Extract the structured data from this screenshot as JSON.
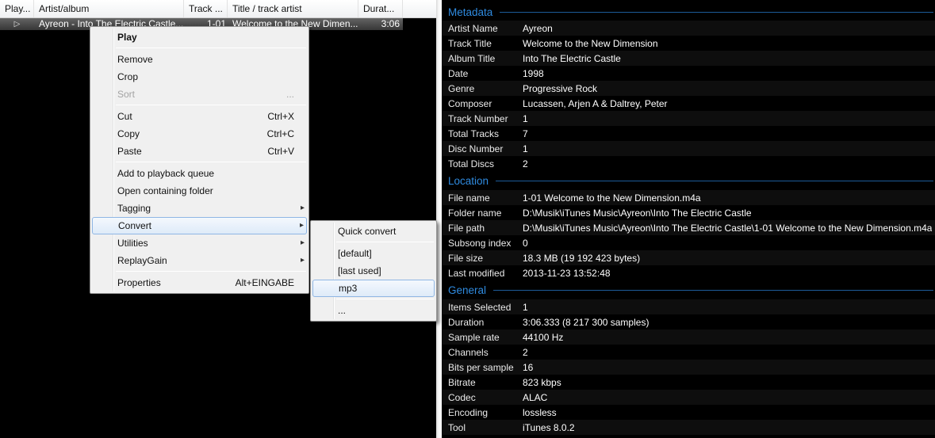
{
  "icons": {
    "play_indicator": "▷",
    "submenu_arrow": "▸"
  },
  "colors": {
    "accent_blue": "#2f8be0",
    "section_line_blue": "#1d5c99",
    "menu_highlight_border": "#8fb6e4",
    "selected_row_gray": "#4a4a4a"
  },
  "playlist": {
    "columns": [
      "Play...",
      "Artist/album",
      "Track ...",
      "Title / track artist",
      "Durat..."
    ],
    "row": {
      "artist_album": "Ayreon - Into The Electric Castle...",
      "track": "1-01",
      "title": "Welcome to the New Dimen...",
      "duration": "3:06"
    }
  },
  "context_menu": {
    "items": [
      {
        "type": "item",
        "label": "Play",
        "bold": true
      },
      {
        "type": "separator"
      },
      {
        "type": "item",
        "label": "Remove"
      },
      {
        "type": "item",
        "label": "Crop"
      },
      {
        "type": "item",
        "label": "Sort",
        "disabled": true,
        "shortcut": "..."
      },
      {
        "type": "separator"
      },
      {
        "type": "item",
        "label": "Cut",
        "shortcut": "Ctrl+X"
      },
      {
        "type": "item",
        "label": "Copy",
        "shortcut": "Ctrl+C"
      },
      {
        "type": "item",
        "label": "Paste",
        "shortcut": "Ctrl+V"
      },
      {
        "type": "separator"
      },
      {
        "type": "item",
        "label": "Add to playback queue"
      },
      {
        "type": "item",
        "label": "Open containing folder"
      },
      {
        "type": "item",
        "label": "Tagging",
        "submenu": true
      },
      {
        "type": "item",
        "label": "Convert",
        "submenu": true,
        "highlighted": true
      },
      {
        "type": "item",
        "label": "Utilities",
        "submenu": true
      },
      {
        "type": "item",
        "label": "ReplayGain",
        "submenu": true
      },
      {
        "type": "separator"
      },
      {
        "type": "item",
        "label": "Properties",
        "shortcut": "Alt+EINGABE"
      }
    ]
  },
  "convert_submenu": {
    "items": [
      {
        "type": "item",
        "label": "Quick convert"
      },
      {
        "type": "separator"
      },
      {
        "type": "item",
        "label": "[default]"
      },
      {
        "type": "item",
        "label": "[last used]"
      },
      {
        "type": "item",
        "label": "mp3",
        "highlighted": true
      },
      {
        "type": "separator"
      },
      {
        "type": "item",
        "label": "..."
      }
    ]
  },
  "properties": {
    "sections": [
      {
        "title": "Metadata",
        "rows": [
          {
            "label": "Artist Name",
            "value": "Ayreon"
          },
          {
            "label": "Track Title",
            "value": "Welcome to the New Dimension"
          },
          {
            "label": "Album Title",
            "value": "Into The Electric Castle"
          },
          {
            "label": "Date",
            "value": "1998"
          },
          {
            "label": "Genre",
            "value": "Progressive Rock"
          },
          {
            "label": "Composer",
            "value": "Lucassen, Arjen A & Daltrey, Peter"
          },
          {
            "label": "Track Number",
            "value": "1"
          },
          {
            "label": "Total Tracks",
            "value": "7"
          },
          {
            "label": "Disc Number",
            "value": "1"
          },
          {
            "label": "Total Discs",
            "value": "2"
          }
        ]
      },
      {
        "title": "Location",
        "rows": [
          {
            "label": "File name",
            "value": "1-01 Welcome to the New Dimension.m4a"
          },
          {
            "label": "Folder name",
            "value": "D:\\Musik\\iTunes Music\\Ayreon\\Into The Electric Castle"
          },
          {
            "label": "File path",
            "value": "D:\\Musik\\iTunes Music\\Ayreon\\Into The Electric Castle\\1-01 Welcome to the New Dimension.m4a"
          },
          {
            "label": "Subsong index",
            "value": "0"
          },
          {
            "label": "File size",
            "value": "18.3 MB (19 192 423 bytes)"
          },
          {
            "label": "Last modified",
            "value": "2013-11-23 13:52:48"
          }
        ]
      },
      {
        "title": "General",
        "rows": [
          {
            "label": "Items Selected",
            "value": "1"
          },
          {
            "label": "Duration",
            "value": "3:06.333 (8 217 300 samples)"
          },
          {
            "label": "Sample rate",
            "value": "44100 Hz"
          },
          {
            "label": "Channels",
            "value": "2"
          },
          {
            "label": "Bits per sample",
            "value": "16"
          },
          {
            "label": "Bitrate",
            "value": "823 kbps"
          },
          {
            "label": "Codec",
            "value": "ALAC"
          },
          {
            "label": "Encoding",
            "value": "lossless"
          },
          {
            "label": "Tool",
            "value": "iTunes 8.0.2"
          }
        ]
      }
    ]
  }
}
